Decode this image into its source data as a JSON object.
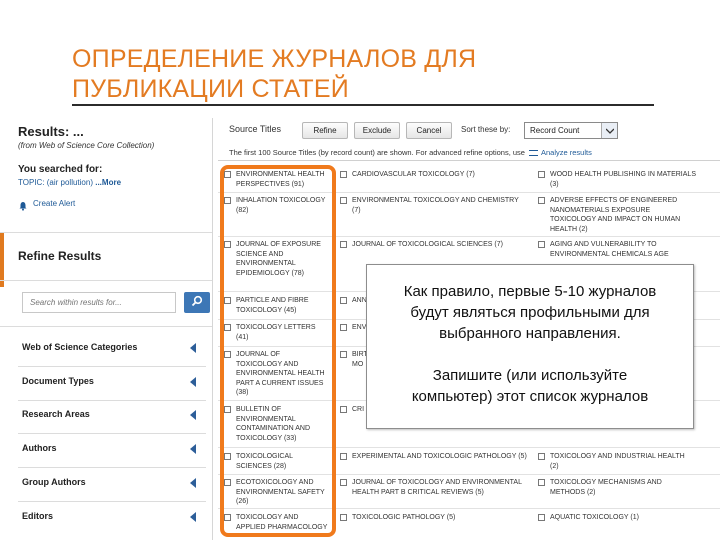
{
  "slide": {
    "title_line1": "ОПРЕДЕЛЕНИЕ ЖУРНАЛОВ ДЛЯ",
    "title_line2": "ПУБЛИКАЦИИ СТАТЕЙ",
    "accent_color": "#e37b22"
  },
  "sidebar": {
    "results_title": "Results: ...",
    "results_sub": "(from Web of Science Core Collection)",
    "searched_label": "You searched for:",
    "topic_prefix": "TOPIC: (air pollution)",
    "more_link": "...More",
    "alert_icon": "bell-icon",
    "alert_label": "Create Alert",
    "refine_title": "Refine Results",
    "search_placeholder": "Search within results for...",
    "search_icon": "search-icon",
    "facets": [
      "Web of Science Categories",
      "Document Types",
      "Research Areas",
      "Authors",
      "Group Authors",
      "Editors"
    ]
  },
  "toolbar": {
    "label": "Source Titles",
    "refine": "Refine",
    "exclude": "Exclude",
    "cancel": "Cancel",
    "sort_label": "Sort these by:",
    "sort_value": "Record Count",
    "notice_text": "The first 100 Source Titles (by record count) are shown. For advanced refine options, use",
    "analyze_link": "Analyze results"
  },
  "columns": [
    [
      "ENVIRONMENTAL HEALTH\nPERSPECTIVES (91)",
      "INHALATION TOXICOLOGY\n(82)",
      "JOURNAL OF EXPOSURE\nSCIENCE AND\nENVIRONMENTAL\nEPIDEMIOLOGY (78)",
      "PARTICLE AND FIBRE\nTOXICOLOGY (45)",
      "TOXICOLOGY LETTERS\n(41)",
      "JOURNAL OF\nTOXICOLOGY AND\nENVIRONMENTAL HEALTH\nPART A CURRENT ISSUES\n(38)",
      "BULLETIN OF\nENVIRONMENTAL\nCONTAMINATION AND\nTOXICOLOGY (33)",
      "TOXICOLOGICAL\nSCIENCES (28)",
      "ECOTOXICOLOGY AND\nENVIRONMENTAL SAFETY\n(26)",
      "TOXICOLOGY AND\nAPPLIED PHARMACOLOGY"
    ],
    [
      "CARDIOVASCULAR TOXICOLOGY (7)",
      "ENVIRONMENTAL TOXICOLOGY AND CHEMISTRY\n(7)",
      "JOURNAL OF TOXICOLOGICAL SCIENCES (7)",
      "ANN",
      "ENV",
      "BIRT\nMO",
      "",
      "CRI",
      "EXPERIMENTAL AND TOXICOLOGIC PATHOLOGY (5)",
      "JOURNAL OF TOXICOLOGY AND ENVIRONMENTAL\nHEALTH PART B CRITICAL REVIEWS (5)",
      "TOXICOLOGIC PATHOLOGY (5)"
    ],
    [
      "WOOD HEALTH PUBLISHING IN MATERIALS\n(3)",
      "ADVERSE EFFECTS OF ENGINEERED\nNANOMATERIALS EXPOSURE\nTOXICOLOGY AND IMPACT ON HUMAN\nHEALTH (2)",
      "AGING AND VULNERABILITY TO\nENVIRONMENTAL CHEMICALS AGE",
      "TOXICOLOGY AND INDUSTRIAL HEALTH\n(2)",
      "TOXICOLOGY MECHANISMS AND\nMETHODS (2)",
      "AQUATIC TOXICOLOGY (1)"
    ]
  ],
  "callout": {
    "line1": "Как правило, первые 5-10 журналов",
    "line2": "будут являться профильными для",
    "line3": "выбранного направления.",
    "line4": "Запишите (или используйте",
    "line5": "компьютер) этот список журналов"
  }
}
